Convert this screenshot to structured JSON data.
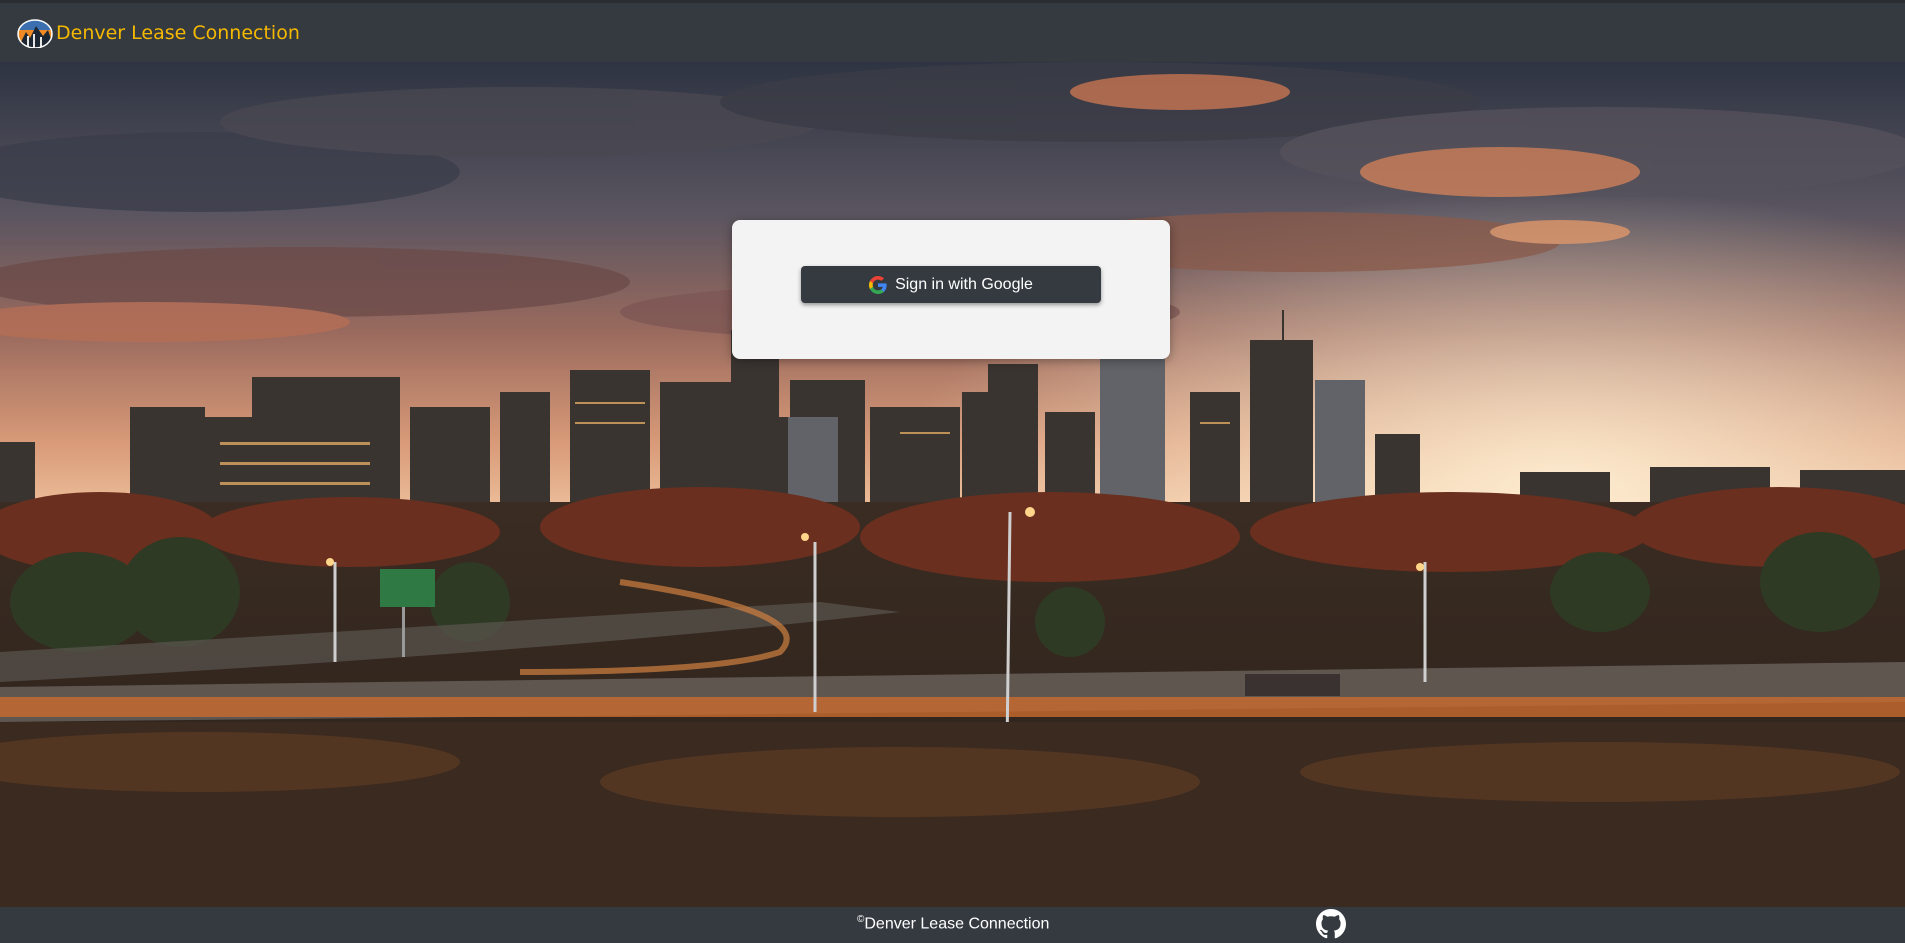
{
  "navbar": {
    "brand_text": "Denver Lease Connection",
    "logo_icon": "denver-skyline-logo-icon",
    "brand_color": "#f5b800",
    "background": "#343a40"
  },
  "hero": {
    "background_image": "denver-skyline-sunset-photo"
  },
  "login": {
    "google_button_label": "Sign in with Google",
    "google_icon": "google-g-icon"
  },
  "footer": {
    "copyright_symbol": "©",
    "copyright_text": "Denver Lease Connection",
    "github_icon": "github-icon"
  }
}
